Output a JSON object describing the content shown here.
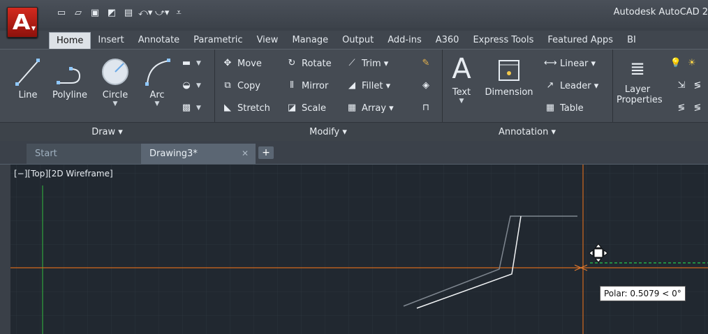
{
  "app": {
    "title": "Autodesk AutoCAD 2",
    "logo_letter": "A"
  },
  "quick_access": [
    "new-icon",
    "open-icon",
    "save-icon",
    "saveas-icon",
    "plot-icon",
    "undo-icon",
    "redo-icon",
    "customize-icon"
  ],
  "tabs": [
    "Home",
    "Insert",
    "Annotate",
    "Parametric",
    "View",
    "Manage",
    "Output",
    "Add-ins",
    "A360",
    "Express Tools",
    "Featured Apps",
    "BI"
  ],
  "active_tab": "Home",
  "panels": {
    "draw": {
      "footer": "Draw ▾",
      "tools": [
        "Line",
        "Polyline",
        "Circle",
        "Arc"
      ]
    },
    "modify": {
      "footer": "Modify ▾",
      "rows": [
        [
          "Move",
          "Rotate",
          "Trim ▾"
        ],
        [
          "Copy",
          "Mirror",
          "Fillet ▾"
        ],
        [
          "Stretch",
          "Scale",
          "Array ▾"
        ]
      ]
    },
    "annotation": {
      "footer": "Annotation ▾",
      "text": "Text",
      "dimension": "Dimension",
      "linear": "Linear ▾",
      "leader": "Leader ▾",
      "table": "Table"
    },
    "layers": {
      "label_line1": "Layer",
      "label_line2": "Properties"
    }
  },
  "doc_tabs": {
    "start": "Start",
    "drawing": "Drawing3*",
    "close": "✕",
    "add": "+"
  },
  "viewport": {
    "label": "[−][Top][2D Wireframe]",
    "tooltip": "Polar: 0.5079 < 0°"
  },
  "colors": {
    "app_red": "#c8231a",
    "crosshair": "#d2691e",
    "y_axis": "#2e8b3a",
    "polar_track": "#22b04a"
  }
}
